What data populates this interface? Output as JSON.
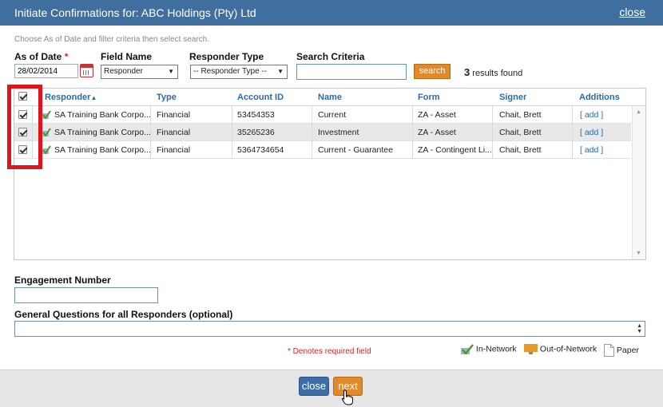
{
  "dialog": {
    "title": "Initiate Confirmations for: ABC Holdings (Pty) Ltd",
    "close_link": "close"
  },
  "instructions": "Choose As of Date and filter criteria then select search.",
  "filters": {
    "as_of_date_label": "As of Date",
    "required_mark": "*",
    "as_of_date_value": "28/02/2014",
    "field_name_label": "Field Name",
    "field_name_value": "Responder",
    "responder_type_label": "Responder Type",
    "responder_type_value": "-- Responder Type --",
    "search_criteria_label": "Search Criteria",
    "search_criteria_value": "",
    "search_button": "search",
    "results_count": "3",
    "results_text": "results found"
  },
  "grid": {
    "headers": [
      "Responder",
      "Type",
      "Account ID",
      "Name",
      "Form",
      "Signer",
      "Additions"
    ],
    "sort_indicator": "▲",
    "rows": [
      {
        "responder": "SA Training Bank Corpo...",
        "type": "Financial",
        "account_id": "53454353",
        "name": "Current",
        "form": "ZA - Asset",
        "signer": "Chait, Brett",
        "additions": "[ add ]",
        "checked": true
      },
      {
        "responder": "SA Training Bank Corpo...",
        "type": "Financial",
        "account_id": "35265236",
        "name": "Investment",
        "form": "ZA - Asset",
        "signer": "Chait, Brett",
        "additions": "[ add ]",
        "checked": true
      },
      {
        "responder": "SA Training Bank Corpo...",
        "type": "Financial",
        "account_id": "5364734654",
        "name": "Current - Guarantee",
        "form": "ZA - Contingent Li...",
        "signer": "Chait, Brett",
        "additions": "[ add ]",
        "checked": true
      }
    ]
  },
  "engagement_number_label": "Engagement Number",
  "general_questions_label": "General Questions for all Responders (optional)",
  "required_note": "* Denotes required field",
  "legend": {
    "in_network": "In-Network",
    "out_of_network": "Out-of-Network",
    "paper": "Paper"
  },
  "buttons": {
    "close": "close",
    "next": "next"
  },
  "colors": {
    "title_bar": "#3f6f9f",
    "accent_orange": "#e08a2c",
    "highlight_red": "#e0141c",
    "link_blue": "#2d6aa5"
  }
}
